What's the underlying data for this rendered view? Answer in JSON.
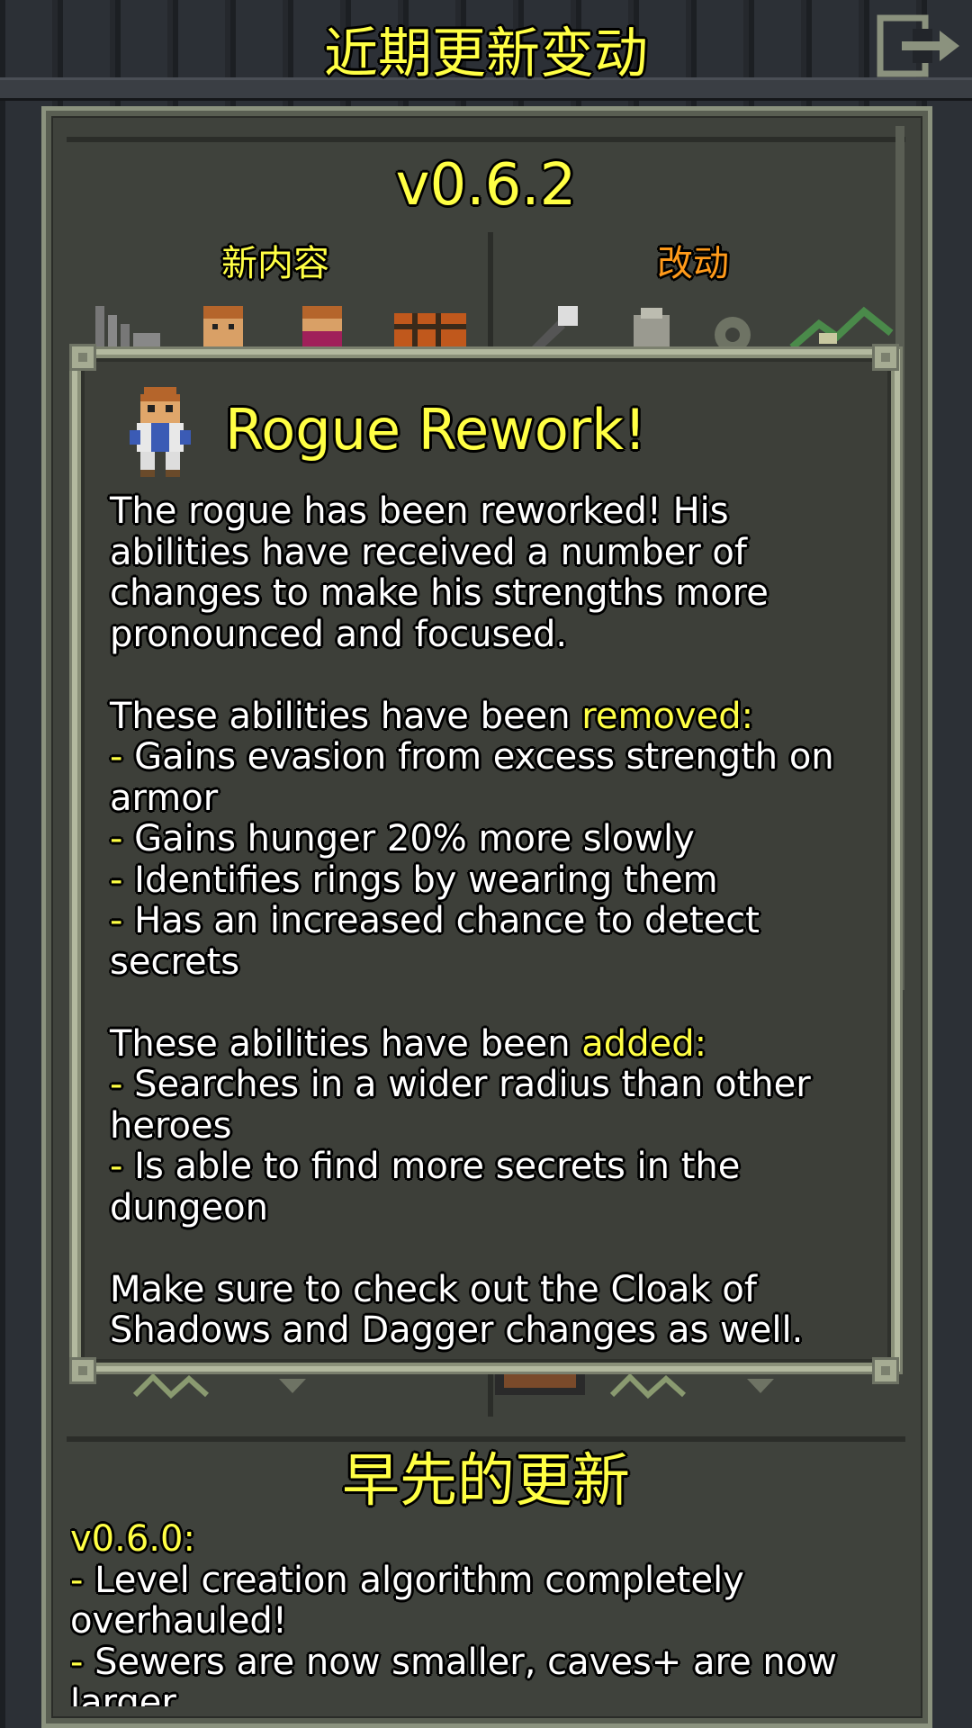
{
  "header": {
    "title": "近期更新变动"
  },
  "changelog": {
    "version": "v0.6.2",
    "col_new": "新内容",
    "col_changes": "改动"
  },
  "modal": {
    "title": "Rogue Rework!",
    "intro": "The rogue has been reworked! His abilities have received a number of changes to make his strengths more pronounced and focused.",
    "removed_prefix": "These abilities have been ",
    "removed_word": "removed:",
    "removed_items": [
      "Gains evasion from excess strength on armor",
      "Gains hunger 20% more slowly",
      "Identifies rings by wearing them",
      "Has an increased chance to detect secrets"
    ],
    "added_prefix": "These abilities have been ",
    "added_word": "added:",
    "added_items": [
      "Searches in a wider radius than other heroes",
      "Is able to find more secrets in the dungeon"
    ],
    "outro": "Make sure to check out the Cloak of Shadows and Dagger changes as well."
  },
  "previous": {
    "title": "早先的更新",
    "version": "v0.6.0:",
    "items": [
      "Level creation algorithm completely overhauled!",
      "Sewers are now smaller, caves+ are now larger"
    ]
  },
  "icons": {
    "exit": "exit-door-icon",
    "modal_hero": "rogue-hero-sprite"
  },
  "colors": {
    "title_yellow": "#ffff44",
    "changes_orange": "#ff9a1a",
    "panel": "#3f423c"
  }
}
